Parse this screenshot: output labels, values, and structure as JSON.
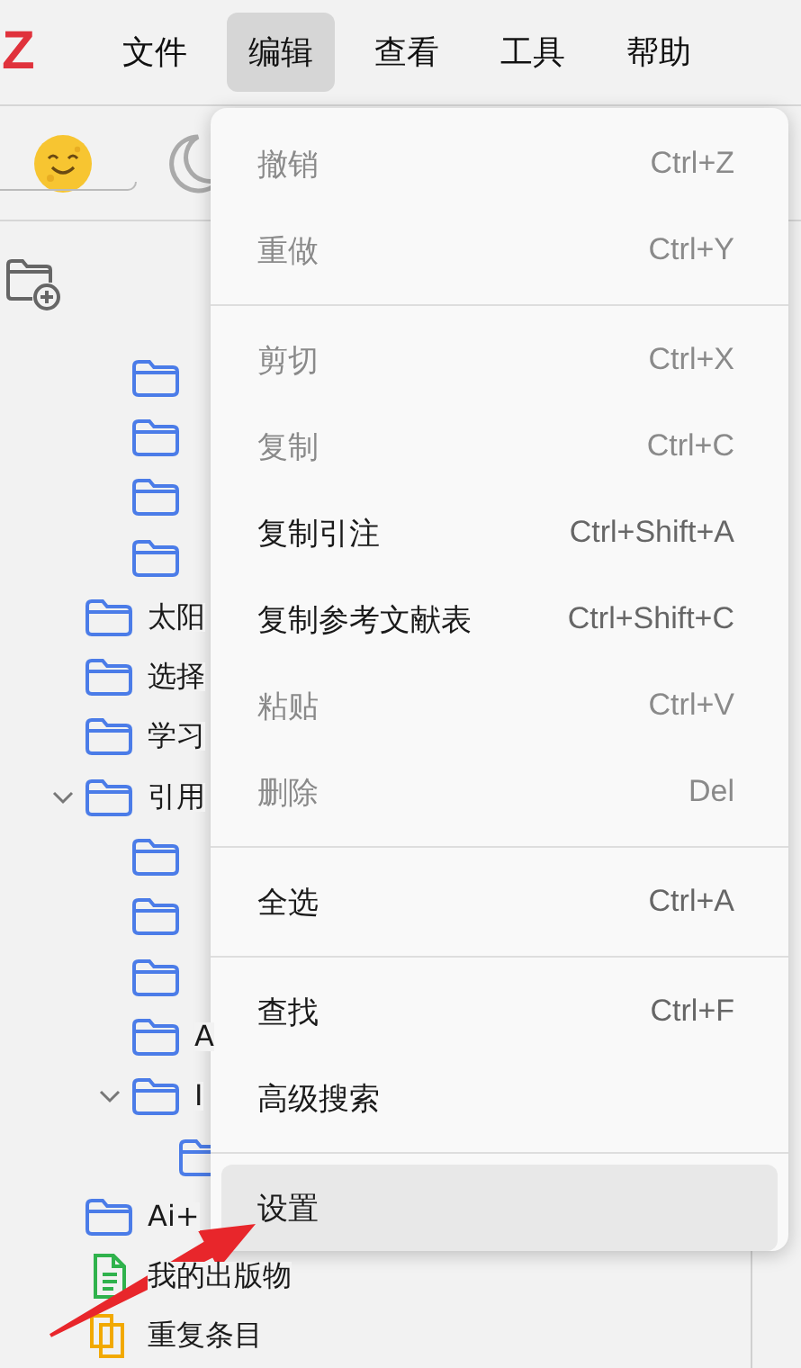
{
  "app": {
    "logo": "Z"
  },
  "menubar": [
    {
      "label": "文件",
      "selected": false
    },
    {
      "label": "编辑",
      "selected": true
    },
    {
      "label": "查看",
      "selected": false
    },
    {
      "label": "工具",
      "selected": false
    },
    {
      "label": "帮助",
      "selected": false
    }
  ],
  "toolbar": [
    {
      "kind": "smiley"
    },
    {
      "kind": "moon"
    }
  ],
  "sidebar": {
    "tool": {
      "kind": "new-collection"
    },
    "tree": [
      {
        "children": [
          {
            "kind": "folder"
          },
          {
            "kind": "folder"
          },
          {
            "kind": "folder"
          },
          {
            "kind": "folder"
          }
        ]
      },
      {
        "kind": "folder",
        "label": "太阳"
      },
      {
        "kind": "folder",
        "label": "选择"
      },
      {
        "kind": "folder",
        "label": "学习"
      },
      {
        "kind": "folder",
        "label": "引用",
        "expanded": true,
        "children": [
          {
            "kind": "folder"
          },
          {
            "kind": "folder"
          },
          {
            "kind": "folder"
          },
          {
            "kind": "folder",
            "label": "A"
          },
          {
            "kind": "folder",
            "label": "I",
            "expanded": true,
            "children": [
              {
                "kind": "folder"
              }
            ]
          }
        ]
      },
      {
        "kind": "folder",
        "label": "Ai+"
      },
      {
        "kind": "publications",
        "label": "我的出版物"
      },
      {
        "kind": "duplicates",
        "label": "重复条目"
      }
    ]
  },
  "menu": {
    "groups": [
      [
        {
          "label": "撤销",
          "shortcut": "Ctrl+Z",
          "disabled": true,
          "highlighted": false
        },
        {
          "label": "重做",
          "shortcut": "Ctrl+Y",
          "disabled": true,
          "highlighted": false
        }
      ],
      [
        {
          "label": "剪切",
          "shortcut": "Ctrl+X",
          "disabled": true,
          "highlighted": false
        },
        {
          "label": "复制",
          "shortcut": "Ctrl+C",
          "disabled": true,
          "highlighted": false
        },
        {
          "label": "复制引注",
          "shortcut": "Ctrl+Shift+A",
          "disabled": false,
          "highlighted": false
        },
        {
          "label": "复制参考文献表",
          "shortcut": "Ctrl+Shift+C",
          "disabled": false,
          "highlighted": false
        },
        {
          "label": "粘贴",
          "shortcut": "Ctrl+V",
          "disabled": true,
          "highlighted": false
        },
        {
          "label": "删除",
          "shortcut": "Del",
          "disabled": true,
          "highlighted": false
        }
      ],
      [
        {
          "label": "全选",
          "shortcut": "Ctrl+A",
          "disabled": false,
          "highlighted": false
        }
      ],
      [
        {
          "label": "查找",
          "shortcut": "Ctrl+F",
          "disabled": false,
          "highlighted": false
        },
        {
          "label": "高级搜索",
          "disabled": false,
          "highlighted": false
        }
      ],
      [
        {
          "label": "设置",
          "disabled": false,
          "highlighted": true
        }
      ]
    ]
  },
  "annotation": {
    "kind": "arrow"
  }
}
